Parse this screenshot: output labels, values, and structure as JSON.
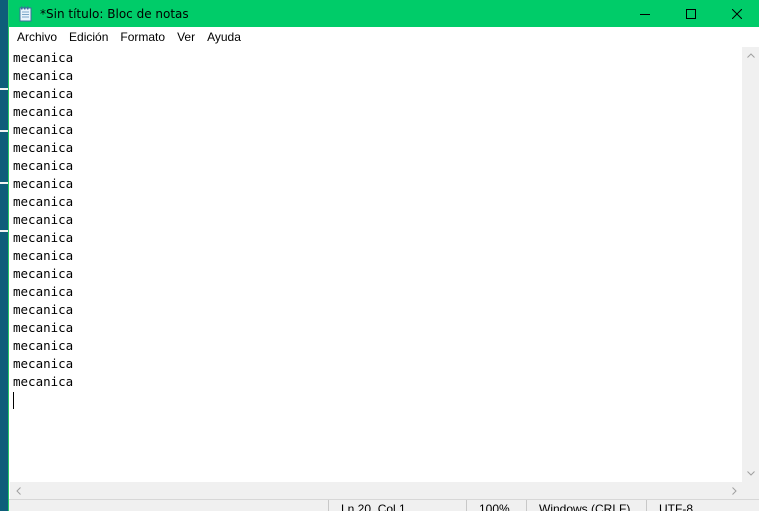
{
  "window": {
    "title": "*Sin título: Bloc de notas",
    "accent_color": "#00cc69",
    "icon": "notepad-icon"
  },
  "controls": {
    "minimize_icon": "minimize-icon",
    "maximize_icon": "maximize-icon",
    "close_icon": "close-icon"
  },
  "menu": {
    "items": [
      "Archivo",
      "Edición",
      "Formato",
      "Ver",
      "Ayuda"
    ]
  },
  "editor": {
    "lines": [
      "mecanica",
      "mecanica",
      "mecanica",
      "mecanica",
      "mecanica",
      "mecanica",
      "mecanica",
      "mecanica",
      "mecanica",
      "mecanica",
      "mecanica",
      "mecanica",
      "mecanica",
      "mecanica",
      "mecanica",
      "mecanica",
      "mecanica",
      "mecanica",
      "mecanica"
    ]
  },
  "statusbar": {
    "position": "Ln 20, Col 1",
    "zoom": "100%",
    "line_ending": "Windows (CRLF)",
    "encoding": "UTF-8"
  }
}
